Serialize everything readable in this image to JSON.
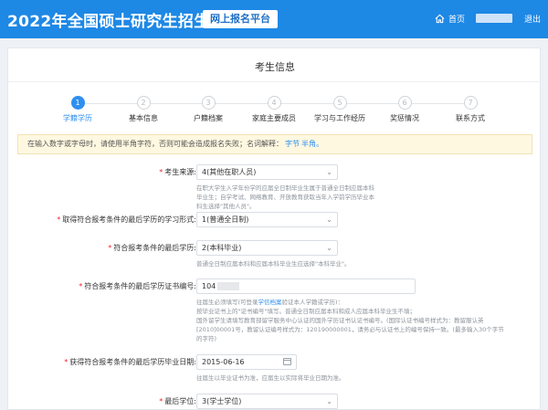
{
  "header": {
    "title": "2022年全国硕士研究生招生考试",
    "platform": "网上报名平台",
    "home_label": "首页",
    "logout_label": "退出"
  },
  "page": {
    "title": "考生信息"
  },
  "steps": [
    {
      "number": "1",
      "label": "学籍学历",
      "active": true
    },
    {
      "number": "2",
      "label": "基本信息",
      "active": false
    },
    {
      "number": "3",
      "label": "户籍档案",
      "active": false
    },
    {
      "number": "4",
      "label": "家庭主要成员",
      "active": false
    },
    {
      "number": "5",
      "label": "学习与工作经历",
      "active": false
    },
    {
      "number": "6",
      "label": "奖惩情况",
      "active": false
    },
    {
      "number": "7",
      "label": "联系方式",
      "active": false
    }
  ],
  "notice": {
    "text": "在输入数字或字母时，请使用半角字符，否则可能会造成报名失败；名词解释：",
    "link1": "字节",
    "link2": "半角。"
  },
  "form": {
    "source": {
      "label": "考生来源:",
      "value": "4(其他在职人员)",
      "help": "在职大学生入学年份学的应届全日制毕业生属于普通全日制应届本科毕业生；自学考试、网络教育、开放教育获取当年入学前学历毕业本科生选择\"其他人员\"。"
    },
    "study_mode": {
      "label": "取得符合报考条件的最后学历的学习形式:",
      "value": "1(普通全日制)"
    },
    "last_degree": {
      "label": "符合报考条件的最后学历:",
      "value": "2(本科毕业)",
      "help": "普通全日制应届本科和应届本科毕业生应选择\"本科毕业\"。"
    },
    "cert_number": {
      "label": "符合报考条件的最后学历证书编号:",
      "value": "104",
      "help_prefix": "往届生必须填写(可登录",
      "help_link": "学信档案",
      "help_suffix": "验证本人学籍或学历)：",
      "help_line2": "按毕业证书上的\"证书编号\"填写。普通全日制应届本科和成人应届本科毕业生不填；",
      "help_line3": "国外留学生请填写教育部留学服务中心认证的国外学历证书认证书编号。(国际认证书编号样式为：教留服认英[2010]00001号，教留认证编号样式为：120190000001，请务必与认证书上的编号保持一致。(最多输入30个字节的字符)"
    },
    "grad_date": {
      "label": "获得符合报考条件的最后学历毕业日期:",
      "value": "2015-06-16",
      "help": "往届生以毕业证书为准，应届生以实际将毕业日期为准。"
    },
    "final_degree": {
      "label": "最后学位:",
      "value": "3(学士学位)"
    }
  },
  "colors": {
    "header": "#1e88e5",
    "accent": "#2f8ff0",
    "notice_bg": "#fff8e1",
    "required": "#f5222d"
  }
}
